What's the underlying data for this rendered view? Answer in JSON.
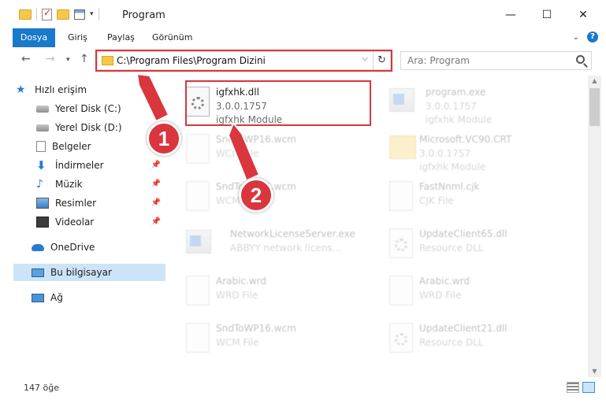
{
  "window": {
    "title": "Program",
    "minimize": "—",
    "maximize": "☐",
    "close": "✕"
  },
  "ribbon": {
    "tabs": [
      "Dosya",
      "Giriş",
      "Paylaş",
      "Görünüm"
    ]
  },
  "address": {
    "path": "C:\\Program Files\\Program Dizini",
    "search_placeholder": "Ara: Program"
  },
  "nav": {
    "items": [
      {
        "label": "Hızlı erişim",
        "icon": "star-icon"
      },
      {
        "label": "Yerel Disk (C:)",
        "icon": "disk-icon"
      },
      {
        "label": "Yerel Disk (D:)",
        "icon": "disk-icon"
      },
      {
        "label": "Belgeler",
        "icon": "documents-icon"
      },
      {
        "label": "İndirmeler",
        "icon": "downloads-icon"
      },
      {
        "label": "Müzik",
        "icon": "music-icon"
      },
      {
        "label": "Resimler",
        "icon": "pictures-icon"
      },
      {
        "label": "Videolar",
        "icon": "videos-icon"
      },
      {
        "label": "OneDrive",
        "icon": "onedrive-icon"
      },
      {
        "label": "Bu bilgisayar",
        "icon": "computer-icon"
      },
      {
        "label": "Ağ",
        "icon": "network-icon"
      }
    ]
  },
  "files": [
    {
      "name": "igfxhk.dll",
      "line1": "3.0.0.1757",
      "line2": "igfxhk Module"
    },
    {
      "name": "program.exe",
      "line1": "3.0.0.1757",
      "line2": "igfxhk Module"
    },
    {
      "name": "SndToWP16.wcm",
      "line1": "WCM File",
      "line2": ""
    },
    {
      "name": "Microsoft.VC90.CRT",
      "line1": "3.0.0.1757",
      "line2": "igfxhk Module"
    },
    {
      "name": "SndToWP15.wcm",
      "line1": "WCM File",
      "line2": ""
    },
    {
      "name": "FastNnml.cjk",
      "line1": "CJK File",
      "line2": ""
    },
    {
      "name": "NetworkLicenseServer.exe",
      "line1": "ABBYY network licens...",
      "line2": ""
    },
    {
      "name": "UpdateClient65.dll",
      "line1": "Resource DLL",
      "line2": ""
    },
    {
      "name": "Arabic.wrd",
      "line1": "WRD File",
      "line2": ""
    },
    {
      "name": "Arabic.wrd",
      "line1": "WRD File",
      "line2": ""
    },
    {
      "name": "SndToWP16.wcm",
      "line1": "WCM File",
      "line2": ""
    },
    {
      "name": "UpdateClient21.dll",
      "line1": "Resource DLL",
      "line2": ""
    }
  ],
  "status": {
    "count": "147 öğe"
  },
  "callouts": [
    "1",
    "2"
  ],
  "colors": {
    "accent": "#1979ca",
    "highlight": "#d9363e",
    "selected": "#cce4f7"
  }
}
